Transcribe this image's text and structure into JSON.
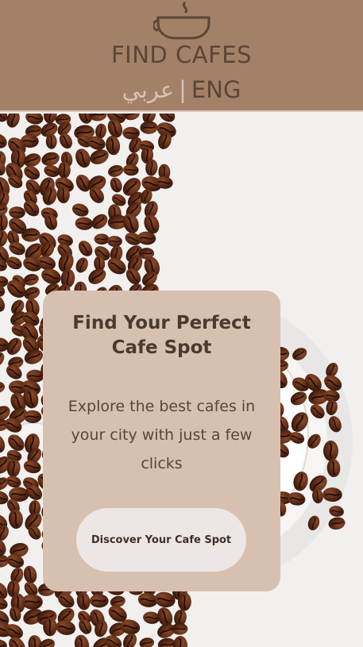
{
  "header": {
    "brand_title": "FIND CAFES",
    "lang_arabic": "عربي",
    "lang_separator": "|",
    "lang_english": "ENG",
    "icon": "coffee-cup-icon"
  },
  "hero": {
    "title": "Find Your Perfect Cafe Spot",
    "description": "Explore the best cafes in your city with just a few clicks",
    "cta_label": "Discover Your Cafe Spot"
  },
  "colors": {
    "header_bg": "#a38168",
    "card_bg": "#d8c0b0",
    "button_bg": "#ece6e4",
    "text_dark": "#4a3a30"
  }
}
